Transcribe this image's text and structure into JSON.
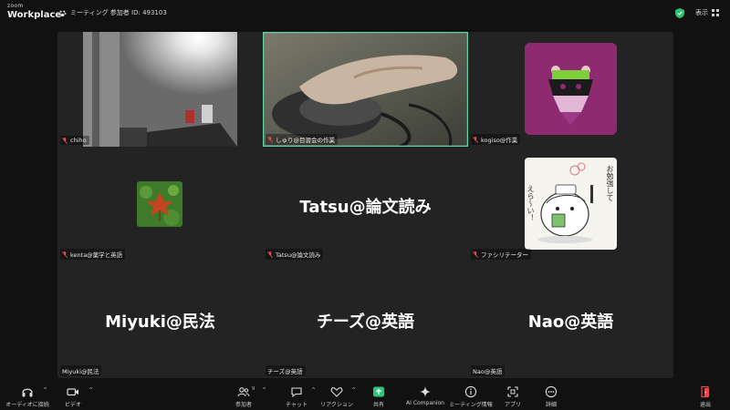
{
  "app": {
    "brand_top": "zoom",
    "brand_bottom": "Workplace"
  },
  "meeting": {
    "info": "ミーティング 参加者 ID: 493103",
    "view_label": "表示"
  },
  "tiles": [
    {
      "name": "chiho",
      "muted": true,
      "kind": "video-room"
    },
    {
      "name": "しゅり@目習会の作業",
      "muted": true,
      "kind": "video-hand",
      "active_speaker": true
    },
    {
      "name": "kogiso@作業",
      "muted": true,
      "kind": "avatar-bee"
    },
    {
      "name": "kenta@薬学と英語",
      "muted": true,
      "kind": "avatar-leaf"
    },
    {
      "name": "Tatsu@論文読み",
      "muted": true,
      "kind": "name-only",
      "display": "Tatsu@論文読み"
    },
    {
      "name": "ファシリテーター",
      "muted": true,
      "kind": "avatar-drawing",
      "drawing_text": [
        "お勉強して",
        "えら〜い！"
      ]
    },
    {
      "name": "Miyuki@民法",
      "muted": false,
      "kind": "name-only",
      "display": "Miyuki@民法"
    },
    {
      "name": "チーズ@英語",
      "muted": false,
      "kind": "name-only",
      "display": "チーズ@英語"
    },
    {
      "name": "Nao@英語",
      "muted": false,
      "kind": "name-only",
      "display": "Nao@英語"
    }
  ],
  "toolbar": {
    "audio": "オーディオに接続",
    "video": "ビデオ",
    "participants": "参加者",
    "participants_count": "9",
    "chat": "チャット",
    "reactions": "リアクション",
    "share": "共有",
    "ai": "AI Companion",
    "meeting_info": "ミーティング情報",
    "apps": "アプリ",
    "more": "詳細",
    "leave": "退出"
  },
  "colors": {
    "active_border": "#5fd3a0",
    "share_green": "#2ec57a",
    "leave_red": "#e5484d",
    "muted_red": "#e5484d",
    "shield_green": "#2fbf71",
    "bee_bg": "#8e2a6f"
  }
}
